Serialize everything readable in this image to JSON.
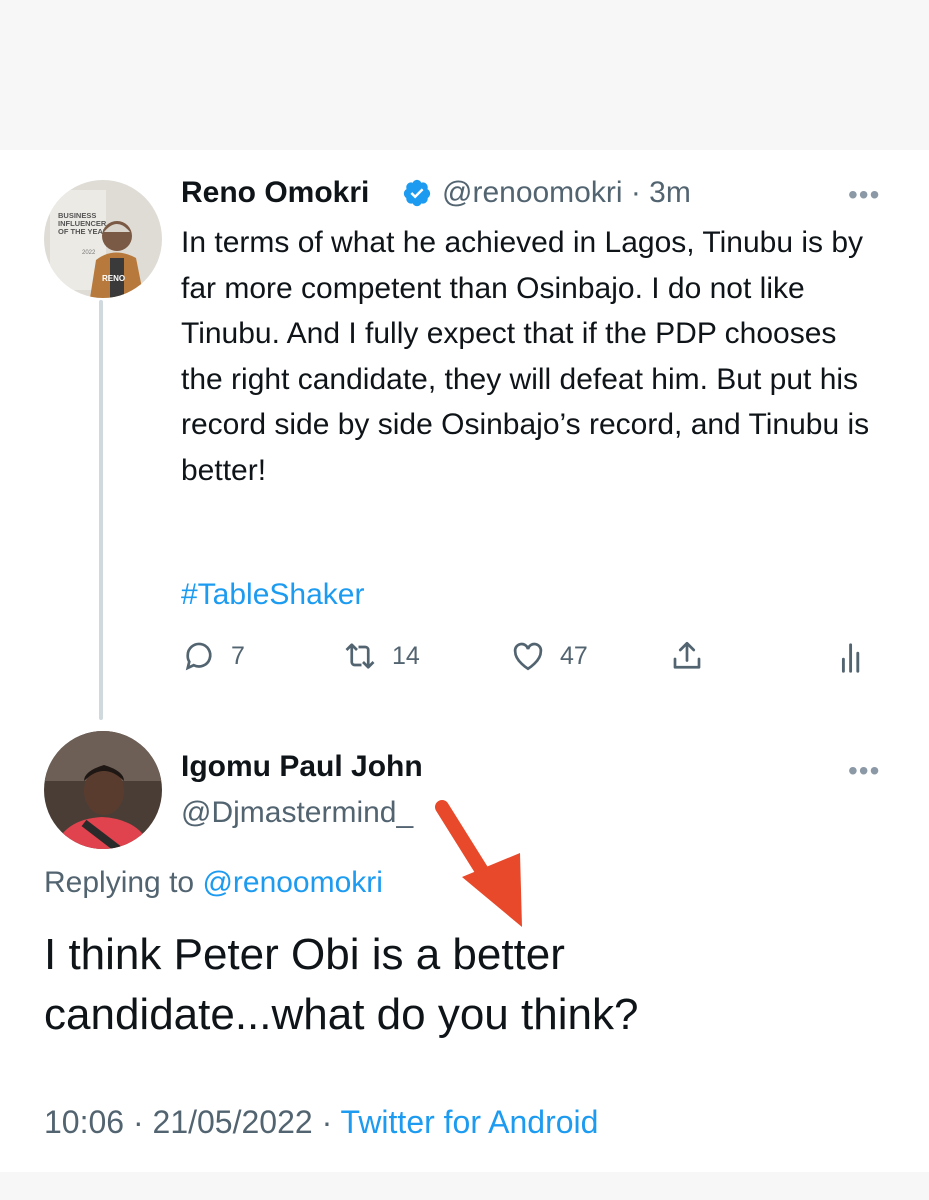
{
  "original_tweet": {
    "author_name": "Reno Omokri",
    "verified_icon": "verified-badge-icon",
    "handle_time": "@renoomokri · 3m",
    "text": "In terms of what he achieved in Lagos, Tinubu is by far more competent than Osinbajo. I do not like Tinubu. And I fully expect that if the PDP chooses the right candidate, they will defeat him. But put his record side by side Osinbajo’s record, and Tinubu is better!",
    "hashtag": "#TableShaker",
    "more_icon": "more-dots-icon",
    "actions": {
      "reply_count": "7",
      "retweet_count": "14",
      "like_count": "47"
    },
    "avatar_text": {
      "line1": "BUSINESS",
      "line2": "INFLUENCER",
      "line3": "OF THE YEAR",
      "year": "2022",
      "brand": "RENO"
    }
  },
  "reply_tweet": {
    "author_name": "Igomu Paul John",
    "handle": "@Djmastermind_",
    "replying_prefix": "Replying to ",
    "replying_mention": "@renoomokri",
    "text": "I think Peter Obi is a better candidate...what do you think?",
    "time_date": "10:06 · 21/05/2022 · ",
    "source": "Twitter for Android"
  },
  "colors": {
    "accent": "#1d9bf0",
    "secondary_text": "#536471",
    "annotation_arrow": "#e8492a"
  }
}
